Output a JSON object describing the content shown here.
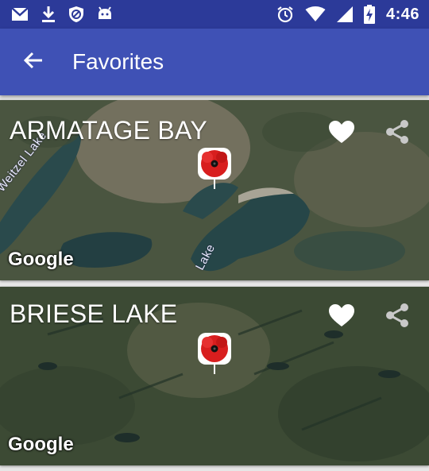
{
  "status_bar": {
    "time": "4:46",
    "left_icons": [
      "gmail-icon",
      "download-icon",
      "shield-icon",
      "android-icon"
    ],
    "right_icons": [
      "alarm-icon",
      "wifi-icon",
      "signal-icon",
      "battery-charging-icon"
    ]
  },
  "app_bar": {
    "back_icon": "arrow-back-icon",
    "title": "Favorites",
    "color": "#3f51b5"
  },
  "favorites": [
    {
      "name": "ARMATAGE BAY",
      "map_labels": [
        "Weitzel Lake",
        "Lake"
      ],
      "map_provider": "Google",
      "favorited": true,
      "icons": [
        "heart-icon",
        "share-icon",
        "poppy-pin-icon"
      ]
    },
    {
      "name": "BRIESE LAKE",
      "map_provider": "Google",
      "favorited": true,
      "icons": [
        "heart-icon",
        "share-icon",
        "poppy-pin-icon"
      ]
    }
  ]
}
